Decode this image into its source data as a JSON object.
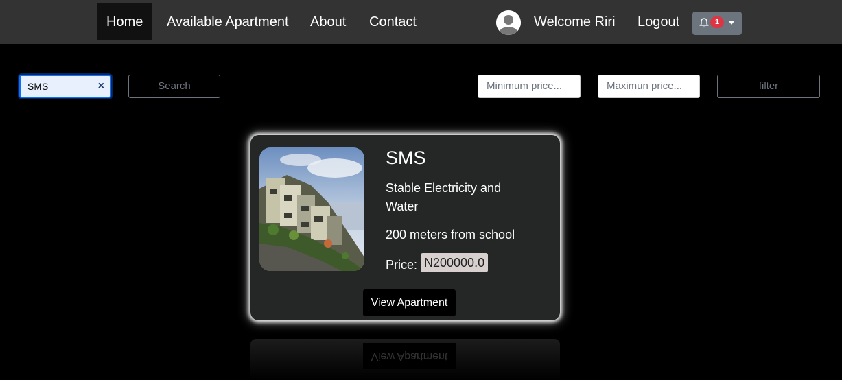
{
  "nav": {
    "items": [
      {
        "label": "Home",
        "active": true
      },
      {
        "label": "Available Apartment",
        "active": false
      },
      {
        "label": "About",
        "active": false
      },
      {
        "label": "Contact",
        "active": false
      }
    ],
    "welcome": "Welcome Riri",
    "logout": "Logout",
    "notification_count": "1"
  },
  "search": {
    "value": "SMS",
    "clear_label": "×",
    "button_label": "Search"
  },
  "filter": {
    "min_placeholder": "Minimum price...",
    "max_placeholder": "Maximun price...",
    "button_label": "filter"
  },
  "card": {
    "title": "SMS",
    "feature1": "Stable Electricity and Water",
    "feature2": "200 meters from school",
    "price_label": "Price:",
    "price_value": "N200000.0",
    "view_button": "View Apartment"
  },
  "reflection": {
    "button_label": "View Apartment"
  },
  "colors": {
    "navbar": "#333333",
    "active_nav": "#111111",
    "card_bg": "#252726",
    "badge": "#dc3545",
    "notif_button": "#6c757d"
  },
  "icons": {
    "avatar": "user-avatar-icon",
    "notification": "bell-icon",
    "dropdown": "chevron-down-icon",
    "clear": "close-icon"
  }
}
